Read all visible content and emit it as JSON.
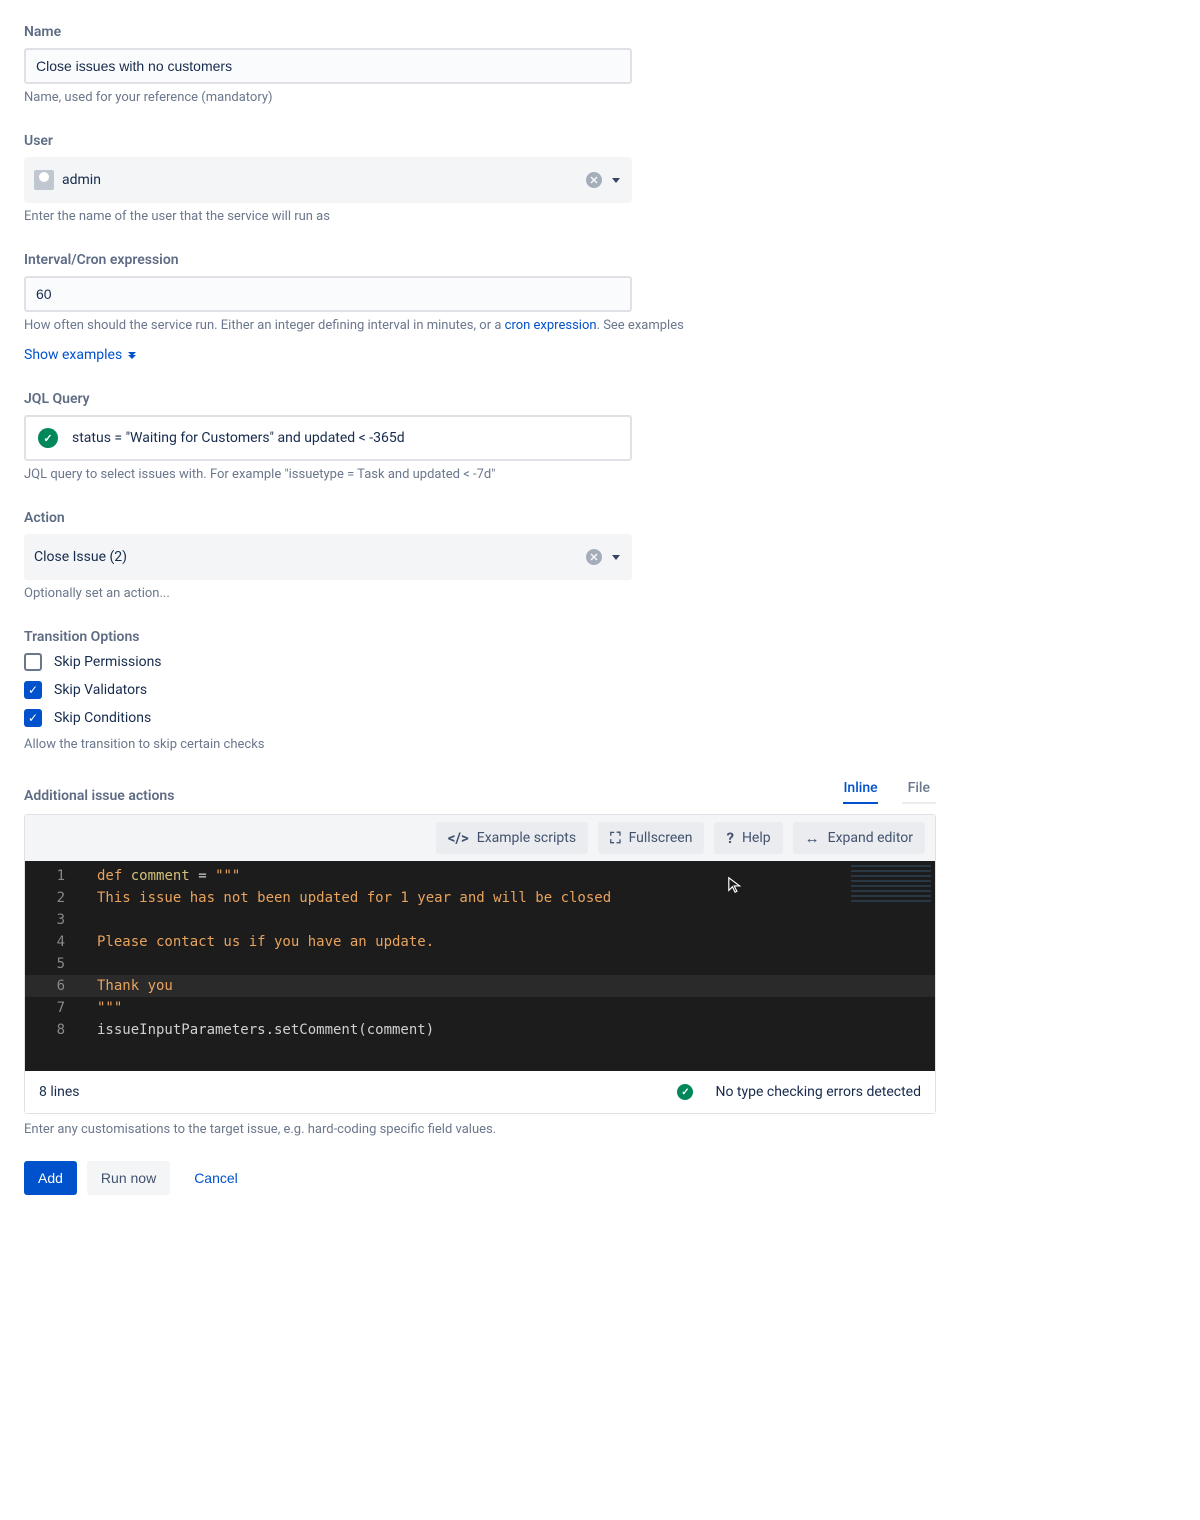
{
  "name": {
    "label": "Name",
    "value": "Close issues with no customers",
    "help": "Name, used for your reference (mandatory)"
  },
  "user": {
    "label": "User",
    "value": "admin",
    "help": "Enter the name of the user that the service will run as"
  },
  "interval": {
    "label": "Interval/Cron expression",
    "value": "60",
    "help_prefix": "How often should the service run. Either an integer defining interval in minutes, or a ",
    "help_link": "cron expression",
    "help_suffix": ". See examples",
    "show_examples": "Show examples"
  },
  "jql": {
    "label": "JQL Query",
    "value": "status = \"Waiting for Customers\" and updated < -365d",
    "help": "JQL query to select issues with. For example \"issuetype = Task and updated < -7d\""
  },
  "action": {
    "label": "Action",
    "value": "Close Issue (2)",
    "help": "Optionally set an action..."
  },
  "transition": {
    "label": "Transition Options",
    "opts": [
      {
        "label": "Skip Permissions",
        "checked": false
      },
      {
        "label": "Skip Validators",
        "checked": true
      },
      {
        "label": "Skip Conditions",
        "checked": true
      }
    ],
    "help": "Allow the transition to skip certain checks"
  },
  "editor": {
    "section_label": "Additional issue actions",
    "tabs": {
      "inline": "Inline",
      "file": "File"
    },
    "toolbar": {
      "example": "Example scripts",
      "fullscreen": "Fullscreen",
      "help": "Help",
      "expand": "Expand editor"
    },
    "code": [
      "def comment = \"\"\"",
      "This issue has not been updated for 1 year and will be closed",
      "",
      "Please contact us if you have an update.",
      "",
      "Thank you",
      "\"\"\"",
      "issueInputParameters.setComment(comment)"
    ],
    "highlighted_line": 6,
    "status_left": "8 lines",
    "status_right": "No type checking errors detected",
    "help": "Enter any customisations to the target issue, e.g. hard-coding specific field values."
  },
  "buttons": {
    "add": "Add",
    "run": "Run now",
    "cancel": "Cancel"
  }
}
